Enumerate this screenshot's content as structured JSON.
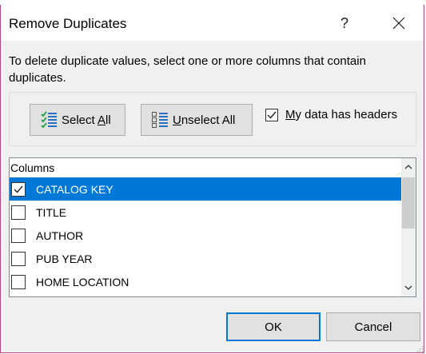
{
  "dialog": {
    "title": "Remove Duplicates",
    "help_glyph": "?",
    "instructions": "To delete duplicate values, select one or more columns that contain duplicates."
  },
  "toolbar": {
    "select_all": {
      "prefix": "Select ",
      "mnemonic": "A",
      "suffix": "ll",
      "icon": "select-all-icon"
    },
    "unselect_all": {
      "prefix": "",
      "mnemonic": "U",
      "suffix": "nselect All",
      "icon": "unselect-all-icon"
    },
    "headers_checkbox": {
      "prefix": "",
      "mnemonic": "M",
      "suffix": "y data has headers",
      "checked": true
    }
  },
  "columns_list": {
    "header": "Columns",
    "items": [
      {
        "label": "CATALOG KEY",
        "checked": true,
        "selected": true
      },
      {
        "label": "TITLE",
        "checked": false,
        "selected": false
      },
      {
        "label": "AUTHOR",
        "checked": false,
        "selected": false
      },
      {
        "label": "PUB YEAR",
        "checked": false,
        "selected": false
      },
      {
        "label": "HOME LOCATION",
        "checked": false,
        "selected": false
      }
    ]
  },
  "footer": {
    "ok_label": "OK",
    "cancel_label": "Cancel"
  },
  "colors": {
    "accent": "#0078d7",
    "window_frame": "#b14a82",
    "dialog_bg": "#f0f0f0"
  }
}
